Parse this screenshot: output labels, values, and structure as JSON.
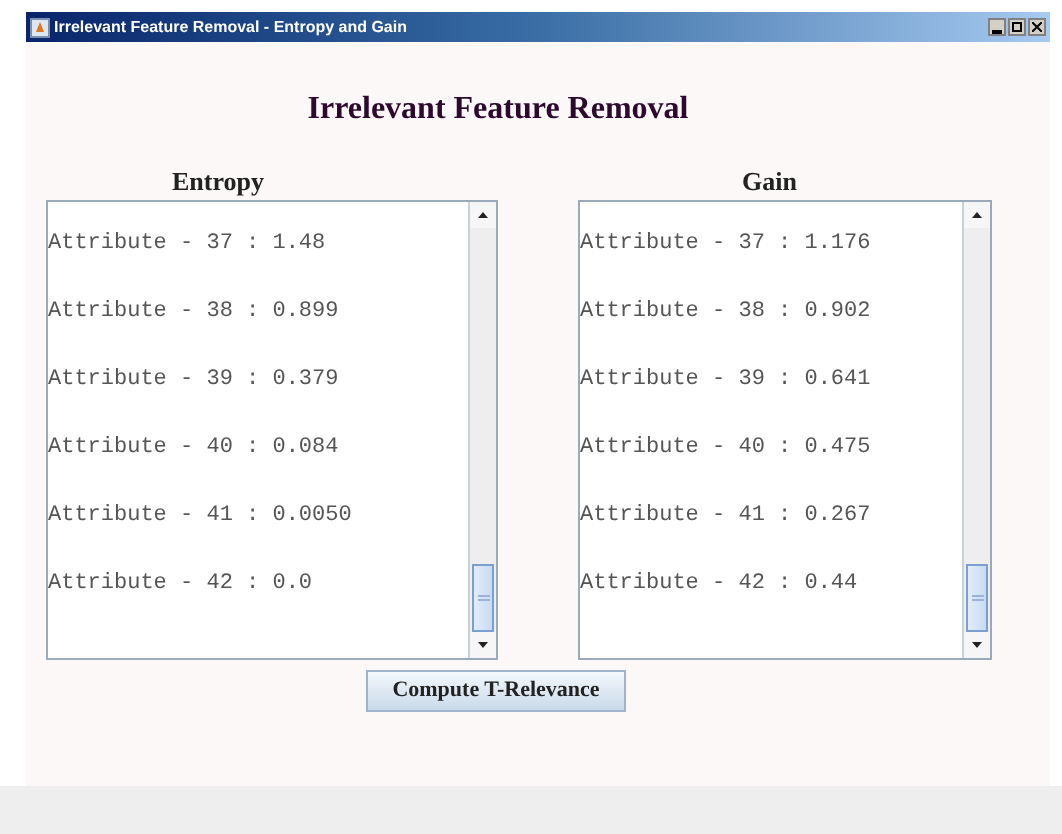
{
  "window": {
    "title": "Irrelevant Feature Removal - Entropy and Gain"
  },
  "heading": "Irrelevant Feature Removal",
  "lists": [
    {
      "label": "Entropy",
      "rows": [
        "Attribute - 37 : 1.48",
        "Attribute - 38 : 0.899",
        "Attribute - 39 : 0.379",
        "Attribute - 40 : 0.084",
        "Attribute - 41 : 0.0050",
        "Attribute - 42 : 0.0"
      ]
    },
    {
      "label": "Gain",
      "rows": [
        "Attribute - 37 : 1.176",
        "Attribute - 38 : 0.902",
        "Attribute - 39 : 0.641",
        "Attribute - 40 : 0.475",
        "Attribute - 41 : 0.267",
        "Attribute - 42 : 0.44"
      ]
    }
  ],
  "button": "Compute T-Relevance"
}
